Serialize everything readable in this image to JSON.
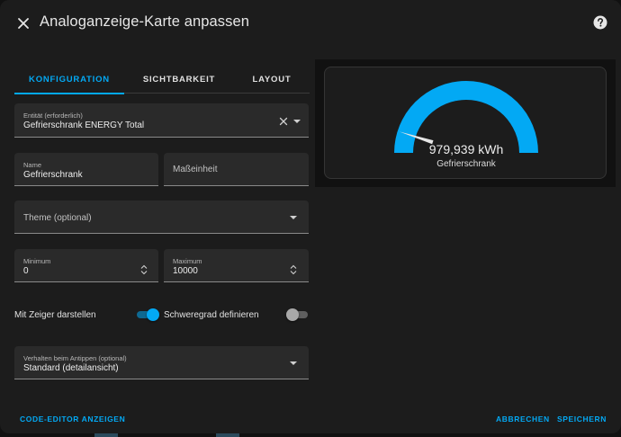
{
  "header": {
    "title": "Analoganzeige-Karte anpassen"
  },
  "tabs": [
    {
      "label": "KONFIGURATION",
      "active": true
    },
    {
      "label": "SICHTBARKEIT",
      "active": false
    },
    {
      "label": "LAYOUT",
      "active": false
    }
  ],
  "entity_field": {
    "label": "Entität (erforderlich)",
    "value": "Gefrierschrank ENERGY Total"
  },
  "name_field": {
    "label": "Name",
    "value": "Gefrierschrank"
  },
  "unit_field": {
    "placeholder": "Maßeinheit"
  },
  "theme_field": {
    "placeholder": "Theme (optional)"
  },
  "min_field": {
    "label": "Minimum",
    "value": "0"
  },
  "max_field": {
    "label": "Maximum",
    "value": "10000"
  },
  "toggles": {
    "needle_label": "Mit Zeiger darstellen",
    "needle_on": true,
    "severity_label": "Schweregrad definieren",
    "severity_on": false
  },
  "tap_field": {
    "label": "Verhalten beim Antippen (optional)",
    "value": "Standard (detailansicht)"
  },
  "footer": {
    "code_editor": "CODE-EDITOR ANZEIGEN",
    "cancel": "ABBRECHEN",
    "save": "SPEICHERN"
  },
  "preview": {
    "value_text": "979,939 kWh",
    "name": "Gefrierschrank",
    "value": 979.939,
    "min": 0,
    "max": 10000
  },
  "colors": {
    "accent": "#03a9f4",
    "background": "#1c1c1c",
    "field_bg": "#2a2a2a",
    "switch_off": "#9e9e9e"
  },
  "icons": [
    "close-icon",
    "help-icon",
    "clear-icon",
    "chevron-down-icon",
    "stepper-icon"
  ]
}
